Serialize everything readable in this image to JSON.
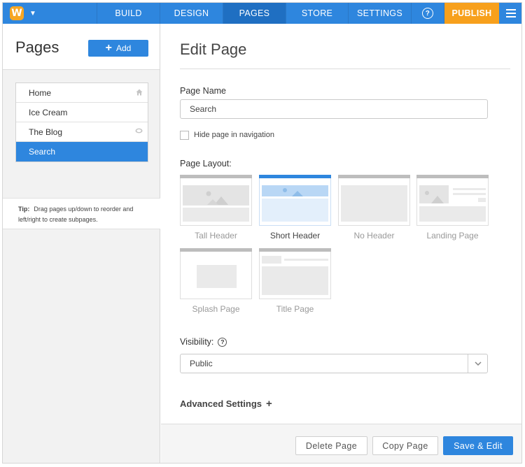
{
  "nav": {
    "logo_letter": "W",
    "items": [
      "BUILD",
      "DESIGN",
      "PAGES",
      "STORE",
      "SETTINGS"
    ],
    "help": "?",
    "publish": "PUBLISH",
    "active": "PAGES",
    "colors": {
      "primary": "#2e86de",
      "publish": "#f7a01c"
    }
  },
  "sidebar": {
    "title": "Pages",
    "add_label": "Add",
    "pages": [
      {
        "label": "Home",
        "icon": "home-icon"
      },
      {
        "label": "Ice Cream",
        "icon": ""
      },
      {
        "label": "The Blog",
        "icon": "comment-icon"
      },
      {
        "label": "Search",
        "icon": "",
        "active": true
      }
    ],
    "tip_label": "Tip:",
    "tip_text": "Drag pages up/down to reorder and left/right to create subpages."
  },
  "main": {
    "title": "Edit Page",
    "page_name_label": "Page Name",
    "page_name_value": "Search",
    "hide_label": "Hide page in navigation",
    "hide_checked": false,
    "layout_label": "Page Layout:",
    "layouts": [
      "Tall Header",
      "Short Header",
      "No Header",
      "Landing Page",
      "Splash Page",
      "Title Page"
    ],
    "selected_layout": "Short Header",
    "visibility_label": "Visibility:",
    "visibility_help": "?",
    "visibility_value": "Public",
    "advanced_label": "Advanced Settings",
    "advanced_plus": "+"
  },
  "footer": {
    "delete_label": "Delete Page",
    "copy_label": "Copy Page",
    "save_label": "Save & Edit"
  }
}
